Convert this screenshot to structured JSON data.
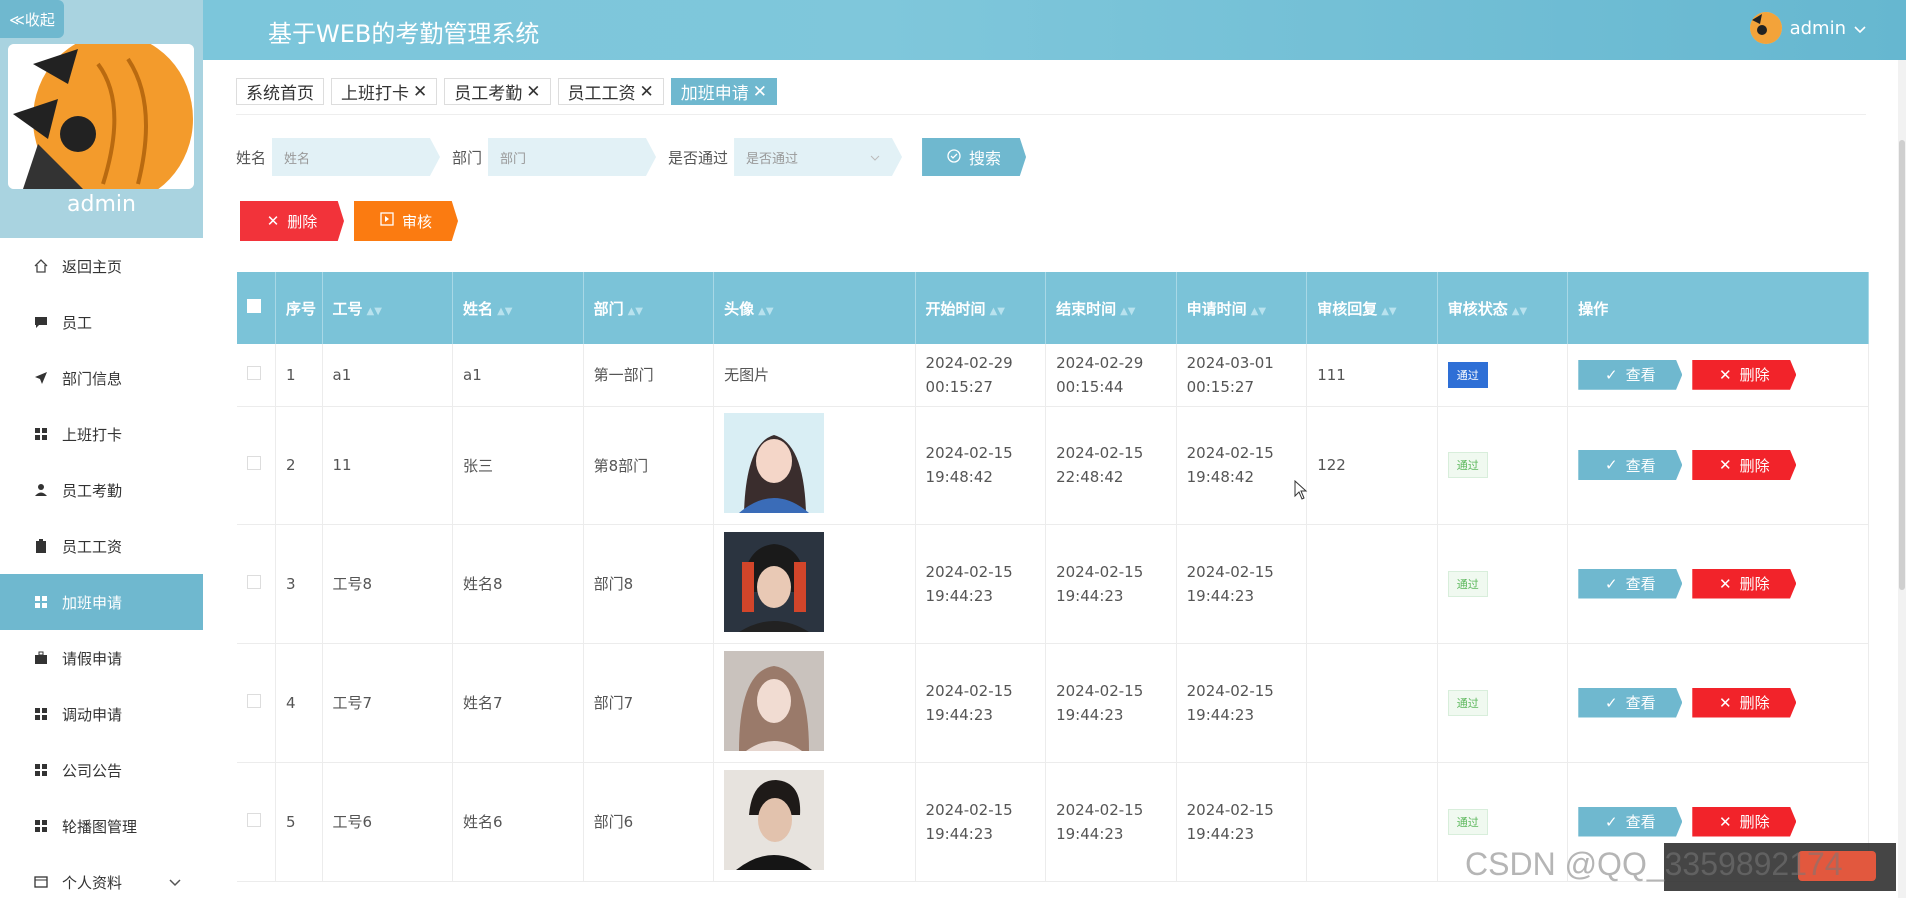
{
  "sidebar": {
    "collapse_label": "≪收起",
    "user_name": "admin",
    "items": [
      {
        "label": "返回主页",
        "icon": "home-icon"
      },
      {
        "label": "员工",
        "icon": "chat-icon"
      },
      {
        "label": "部门信息",
        "icon": "send-icon"
      },
      {
        "label": "上班打卡",
        "icon": "grid-icon"
      },
      {
        "label": "员工考勤",
        "icon": "user-icon"
      },
      {
        "label": "员工工资",
        "icon": "clipboard-icon"
      },
      {
        "label": "加班申请",
        "icon": "grid-icon",
        "active": true
      },
      {
        "label": "请假申请",
        "icon": "briefcase-icon"
      },
      {
        "label": "调动申请",
        "icon": "grid-icon"
      },
      {
        "label": "公司公告",
        "icon": "grid-icon"
      },
      {
        "label": "轮播图管理",
        "icon": "grid-icon"
      },
      {
        "label": "个人资料",
        "icon": "profile-icon"
      }
    ]
  },
  "header": {
    "title": "基于WEB的考勤管理系统",
    "user": "admin"
  },
  "tabs": [
    {
      "label": "系统首页",
      "closable": false
    },
    {
      "label": "上班打卡",
      "closable": true
    },
    {
      "label": "员工考勤",
      "closable": true
    },
    {
      "label": "员工工资",
      "closable": true
    },
    {
      "label": "加班申请",
      "closable": true,
      "active": true
    }
  ],
  "search": {
    "name_label": "姓名",
    "name_placeholder": "姓名",
    "dept_label": "部门",
    "dept_placeholder": "部门",
    "pass_label": "是否通过",
    "pass_placeholder": "是否通过",
    "search_button": "搜索"
  },
  "actions": {
    "delete": "删除",
    "review": "审核"
  },
  "table": {
    "headers": [
      "序号",
      "工号",
      "姓名",
      "部门",
      "头像",
      "开始时间",
      "结束时间",
      "申请时间",
      "审核回复",
      "审核状态",
      "操作"
    ],
    "view_label": "查看",
    "delete_label": "删除",
    "rows": [
      {
        "idx": "1",
        "no": "a1",
        "name": "a1",
        "dept": "第一部门",
        "photo": "无图片",
        "start": "2024-02-29 00:15:27",
        "end": "2024-02-29 00:15:44",
        "apply": "2024-03-01 00:15:27",
        "reply": "111",
        "status": "通过"
      },
      {
        "idx": "2",
        "no": "11",
        "name": "张三",
        "dept": "第8部门",
        "photo": "",
        "start": "2024-02-15 19:48:42",
        "end": "2024-02-15 22:48:42",
        "apply": "2024-02-15 19:48:42",
        "reply": "122",
        "status": "通过"
      },
      {
        "idx": "3",
        "no": "工号8",
        "name": "姓名8",
        "dept": "部门8",
        "photo": "",
        "start": "2024-02-15 19:44:23",
        "end": "2024-02-15 19:44:23",
        "apply": "2024-02-15 19:44:23",
        "reply": "",
        "status": "通过"
      },
      {
        "idx": "4",
        "no": "工号7",
        "name": "姓名7",
        "dept": "部门7",
        "photo": "",
        "start": "2024-02-15 19:44:23",
        "end": "2024-02-15 19:44:23",
        "apply": "2024-02-15 19:44:23",
        "reply": "",
        "status": "通过"
      },
      {
        "idx": "5",
        "no": "工号6",
        "name": "姓名6",
        "dept": "部门6",
        "photo": "",
        "start": "2024-02-15 19:44:23",
        "end": "2024-02-15 19:44:23",
        "apply": "2024-02-15 19:44:23",
        "reply": "",
        "status": "通过"
      }
    ]
  },
  "watermark": "CSDN @QQ_3359892174"
}
